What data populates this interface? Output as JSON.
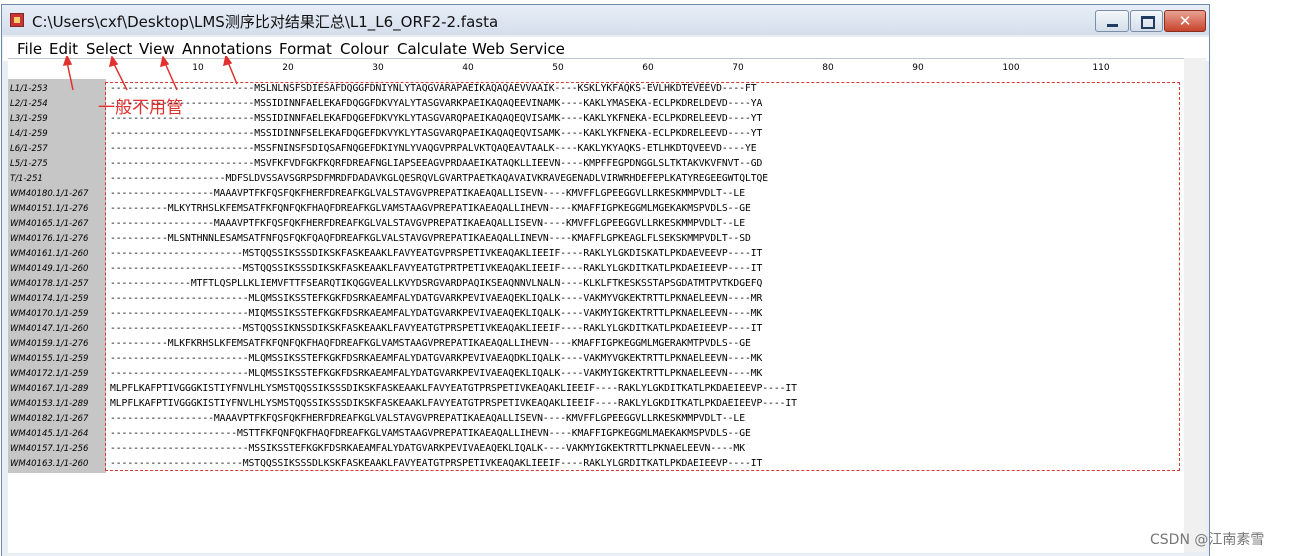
{
  "window": {
    "title": "C:\\Users\\cxf\\Desktop\\LMS测序比对结果汇总\\L1_L6_ORF2-2.fasta",
    "close_glyph": "✕"
  },
  "menu": [
    "File",
    "Edit",
    "Select",
    "View",
    "Annotations",
    "Format",
    "Colour",
    "Calculate",
    "Web Service"
  ],
  "ruler": [
    "10",
    "20",
    "30",
    "40",
    "50",
    "60",
    "70",
    "80",
    "90",
    "100",
    "110"
  ],
  "annotation": {
    "text": "一般不用管",
    "color": "#e0312f"
  },
  "watermark": "CSDN @江南素雪",
  "alignment": {
    "rows": [
      {
        "name": "L1/1-253",
        "seq": "-------------------------MSLNLNSFSDIESAFDQGGFDNIYNLYTAQGVARAPAEIKAQAQAEVVAAIK----KSKLYKFAQKS-EVLHKDTEVEEVD----FT"
      },
      {
        "name": "L2/1-254",
        "seq": "-------------------------MSSIDINNFAELEKAFDQGGFDKVYALYTASGVARKPAEIKAQAQEEVINAMK----KAKLYMASEKA-ECLPKDRELDEVD----YA"
      },
      {
        "name": "L3/1-259",
        "seq": "-------------------------MSSIDINNFAELEKAFDQGEFDKVYKLYTASGVARQPAEIKAQAQEQVISAMK----KAKLYKFNEKA-ECLPKDRELEEVD----YT"
      },
      {
        "name": "L4/1-259",
        "seq": "-------------------------MSSIDINNFSELEKAFDQGEFDKVYKLYTASGVARQPAEIKAQAQEQVISAMK----KAKLYKFNEKA-ECLPKDRELEEVD----YT"
      },
      {
        "name": "L6/1-257",
        "seq": "-------------------------MSSFNINSFSDIQSAFNQGEFDKIYNLYVAQGVPRPALVKTQAQEAVTAALK----KAKLYKYAQKS-ETLHKDTQVEEVD----YE"
      },
      {
        "name": "L5/1-275",
        "seq": "-------------------------MSVFKFVDFGKFKQRFDREAFNGLIAPSEEAGVPRDAAEIKATAQKLLIEEVN----KMPFFEGPDNGGLSLTKTAKVKVFNVT--GD"
      },
      {
        "name": "T/1-251",
        "seq": "--------------------MDFSLDVSSAVSGRPSDFMRDFDADAVKGLQESRQVLGVARTPAETKAQAVAIVKRAVEGENADLVIRWRHDEFEPLKATYREGEEGWTQLTQE"
      },
      {
        "name": "WM40180.1/1-267",
        "seq": "------------------MAAAVPTFKFQSFQKFHERFDREAFKGLVALSTAVGVPREPATIKAEAQALLISEVN----KMVFFLGPEEGGVLLRKESKMMPVDLT--LE"
      },
      {
        "name": "WM40151.1/1-276",
        "seq": "----------MLKYTRHSLKFEMSATFKFQNFQKFHAQFDREAFKGLVAMSTAAGVPREPATIKAEAQALLIHEVN----KMAFFIGPKEGGMLMGEKAKMSPVDLS--GE"
      },
      {
        "name": "WM40165.1/1-267",
        "seq": "------------------MAAAVPTFKFQSFQKFHERFDREAFKGLVALSTAVGVPREPATIKAEAQALLISEVN----KMVFFLGPEEGGVLLRKESKMMPVDLT--LE"
      },
      {
        "name": "WM40176.1/1-276",
        "seq": "----------MLSNTHNNLESAMSATFNFQSFQKFQAQFDREAFKGLVALSTAVGVPREPATIKAEAQALLINEVN----KMAFFLGPKEAGLFLSEKSKMMPVDLT--SD"
      },
      {
        "name": "WM40161.1/1-260",
        "seq": "-----------------------MSTQQSSIKSSSDIKSKFASKEAAKLFAVYEATGVPRSPETIVKEAQAKLIEEIF----RAKLYLGKDISKATLPKDAEVEEVP----IT"
      },
      {
        "name": "WM40149.1/1-260",
        "seq": "-----------------------MSTQQSSIKSSSDIKSKFASKEAAKLFAVYEATGTPRTPETIVKEAQAKLIEEIF----RAKLYLGKDITKATLPKDAEIEEVP----IT"
      },
      {
        "name": "WM40178.1/1-257",
        "seq": "--------------MTFTLQSPLLKLIEMVFTTFSEARQTIKQGGVEALLKVYDSRGVARDPAQIKSEAQNNVLNALN----KLKLFTKESKSSTAPSGDATMTPVTKDGEFQ"
      },
      {
        "name": "WM40174.1/1-259",
        "seq": "------------------------MLQMSSIKSSTEFKGKFDSRKAEAMFALYDATGVARKPEVIVAEAQEKLIQALK----VAKMYVGKEKTRTTLPKNAELEEVN----MR"
      },
      {
        "name": "WM40170.1/1-259",
        "seq": "------------------------MIQMSSIKSSTEFKGKFDSRKAEAMFALYDATGVARKPEVIVAEAQEKLIQALK----VAKMYIGKEKTRTTLPKNAELEEVN----MK"
      },
      {
        "name": "WM40147.1/1-260",
        "seq": "-----------------------MSTQQSSIKNSSDIKSKFASKEAAKLFAVYEATGTPRSPETIVKEAQAKLIEEIF----RAKLYLGKDITKATLPKDAEIEEVP----IT"
      },
      {
        "name": "WM40159.1/1-276",
        "seq": "----------MLKFKRHSLKFEMSATFKFQNFQKFHAQFDREAFKGLVAMSTAAGVPREPATIKAEAQALLIHEVN----KMAFFIGPKEGGMLMGERAKMTPVDLS--GE"
      },
      {
        "name": "WM40155.1/1-259",
        "seq": "------------------------MLQMSSIKSSTEFKGKFDSRKAEAMFALYDATGVARKPEVIVAEAQDKLIQALK----VAKMYVGKEKTRTTLPKNAELEEVN----MK"
      },
      {
        "name": "WM40172.1/1-259",
        "seq": "------------------------MLQMSSIKSSTEFKGKFDSRKAEAMFALYDATGVARKPEVIVAEAQEKLIQALK----VAKMYIGKEKTRTTLPKNAELEEVN----MK"
      },
      {
        "name": "WM40167.1/1-289",
        "seq": "MLPFLKAFPTIVGGGKISTIYFNVLHLYSMSTQQSSIKSSSDIKSKFASKEAAKLFAVYEATGTPRSPETIVKEAQAKLIEEIF----RAKLYLGKDITKATLPKDAEIEEVP----IT"
      },
      {
        "name": "WM40153.1/1-289",
        "seq": "MLPFLKAFPTIVGGGKISTIYFNVLHLYSMSTQQSSIKSSSDIKSKFASKEAAKLFAVYEATGTPRSPETIVKEAQAKLIEEIF----RAKLYLGKDITKATLPKDAEIEEVP----IT"
      },
      {
        "name": "WM40182.1/1-267",
        "seq": "------------------MAAAVPTFKFQSFQKFHERFDREAFKGLVALSTAVGVPREPATIKAEAQALLISEVN----KMVFFLGPEEGGVLLRKESKMMPVDLT--LE"
      },
      {
        "name": "WM40145.1/1-264",
        "seq": "----------------------MSTTFKFQNFQKFHAQFDREAFKGLVAMSTAAGVPREPATIKAEAQALLIHEVN----KMAFFIGPKEGGMLMAEKAKMSPVDLS--GE"
      },
      {
        "name": "WM40157.1/1-256",
        "seq": "------------------------MSSIKSSTEFKGKFDSRKAEAMFALYDATGVARKPEVIVAEAQEKLIQALK----VAKMYIGKEKTRTTLPKNAELEEVN----MK"
      },
      {
        "name": "WM40163.1/1-260",
        "seq": "-----------------------MSTQQSSIKSSSDLKSKFASKEAAKLFAVYEATGTPRSPETIVKEAQAKLIEEIF----RAKLYLGRDITKATLPKDAEIEEVP----IT"
      }
    ]
  }
}
